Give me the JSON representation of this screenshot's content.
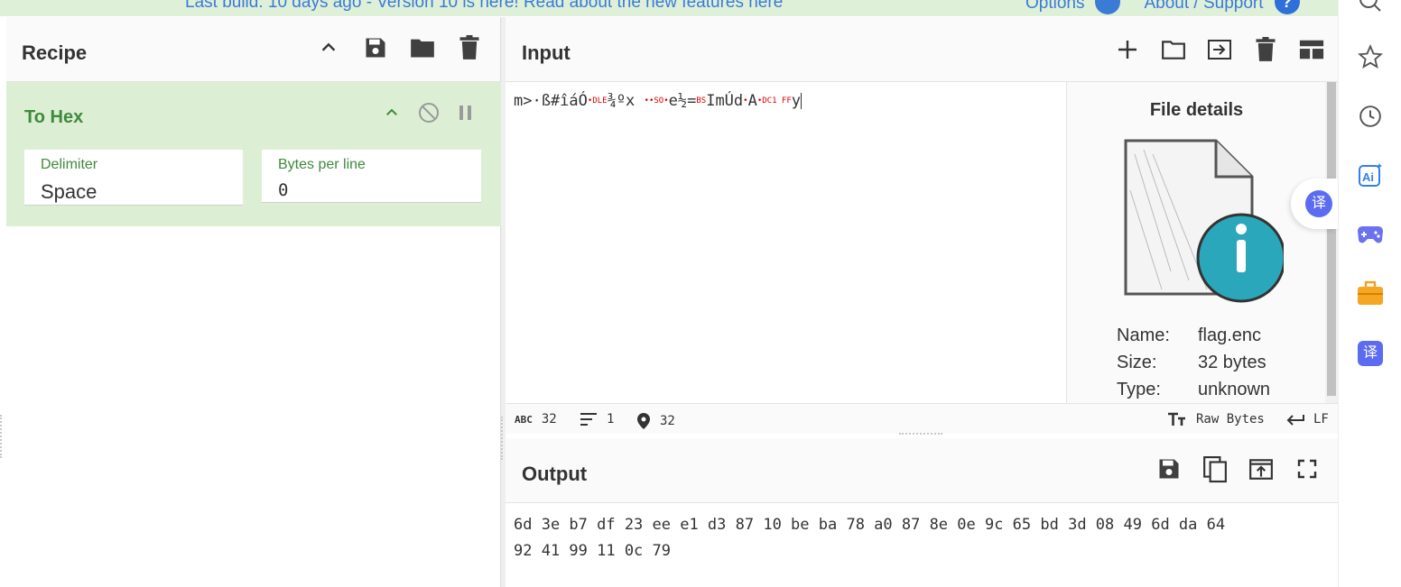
{
  "banner": {
    "text": "Last build: 10 days ago - Version 10 is here! Read about the new features here",
    "options_label": "Options",
    "about_label": "About / Support"
  },
  "recipe": {
    "title": "Recipe",
    "operation": {
      "name": "To Hex",
      "delimiter_label": "Delimiter",
      "delimiter_value": "Space",
      "bytes_per_line_label": "Bytes per line",
      "bytes_per_line_value": "0"
    }
  },
  "input": {
    "title": "Input",
    "text_segments": {
      "s1": "m>·ß#îáÓ",
      "c1": "•",
      "c2": "DLE",
      "s2": "¾ºx ",
      "c3": "••",
      "c4": "SO",
      "c5": "•",
      "s3": "e½=",
      "c6": "BS",
      "s4": "ImÚd",
      "c7": "•",
      "s5": "A",
      "c8": "•",
      "c9": "DC1 FF",
      "s6": "y"
    },
    "file_details": {
      "title": "File details",
      "name_label": "Name:",
      "name_value": "flag.enc",
      "size_label": "Size:",
      "size_value": "32 bytes",
      "type_label": "Type:",
      "type_value": "unknown"
    },
    "status": {
      "chars_icon": "ABC",
      "chars": "32",
      "lines": "1",
      "position": "32",
      "encoding": "Raw Bytes",
      "eol": "LF"
    }
  },
  "output": {
    "title": "Output",
    "line1": "6d 3e b7 df 23 ee e1 d3 87 10 be ba 78 a0 87 8e 0e 9c 65 bd 3d 08 49 6d da 64",
    "line2": "92 41 99 11 0c 79"
  },
  "float_badge": {
    "glyph": "译"
  },
  "sidebar": {
    "ai_label": "Ai",
    "translate_glyph": "译"
  }
}
